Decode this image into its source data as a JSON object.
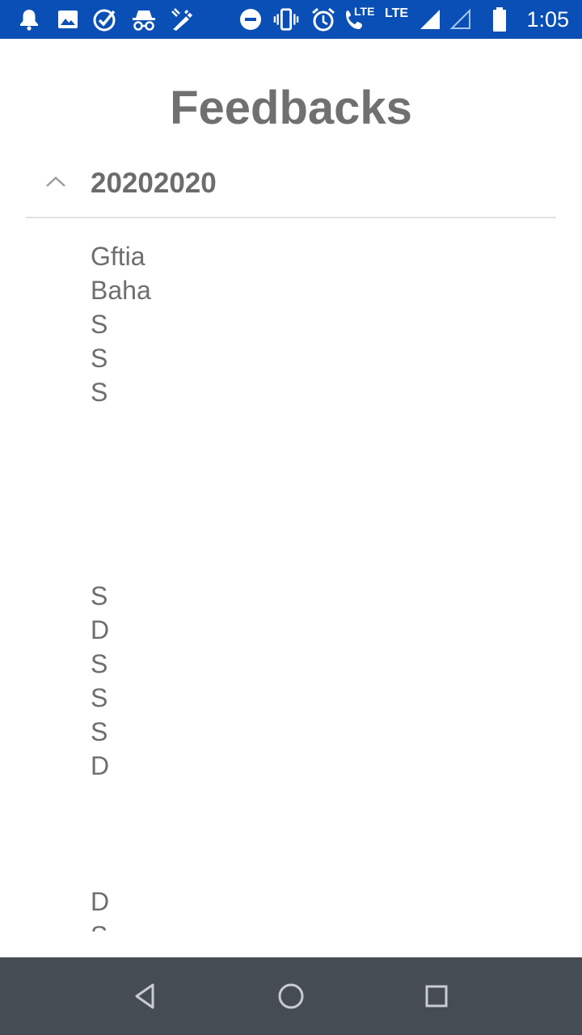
{
  "status_bar": {
    "time": "1:05",
    "lte_1": "LTE",
    "lte_2": "LTE",
    "icons": [
      "notification-bell-icon",
      "image-icon",
      "check-circle-icon",
      "incognito-icon",
      "wrench-pencil-icon",
      "do-not-disturb-icon",
      "vibrate-icon",
      "alarm-clock-icon",
      "volte-call-icon",
      "signal-icon",
      "signal-empty-icon",
      "battery-icon"
    ]
  },
  "page": {
    "title": "Feedbacks"
  },
  "section": {
    "label": "20202020",
    "expanded": true,
    "items": [
      "Gftia",
      "Baha",
      "S",
      "S",
      "S",
      "",
      "",
      "",
      "",
      "",
      "S",
      "D",
      "S",
      "S",
      "S",
      "D",
      "",
      "",
      "",
      "D",
      "S"
    ]
  },
  "nav_bar": {
    "buttons": [
      "back",
      "home",
      "recents"
    ]
  },
  "colors": {
    "status_bar": "#0a4fb5",
    "nav_bar": "#454c53",
    "text": "#6e6e6e",
    "divider": "#e2e2e2"
  }
}
